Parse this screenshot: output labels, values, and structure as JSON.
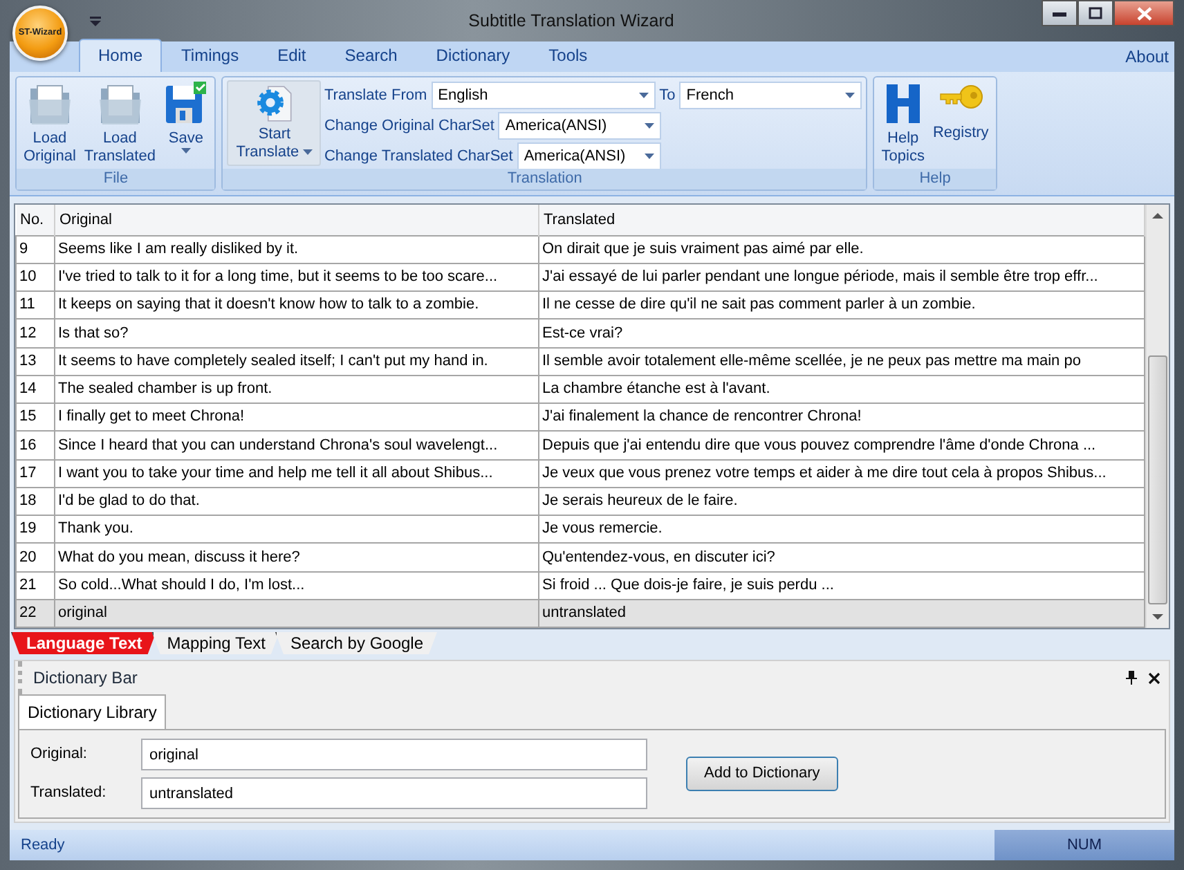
{
  "window": {
    "title": "Subtitle Translation Wizard",
    "app_button": "ST-Wizard"
  },
  "ribbon_tabs": [
    {
      "label": "Home",
      "selected": true
    },
    {
      "label": "Timings",
      "selected": false
    },
    {
      "label": "Edit",
      "selected": false
    },
    {
      "label": "Search",
      "selected": false
    },
    {
      "label": "Dictionary",
      "selected": false
    },
    {
      "label": "Tools",
      "selected": false
    }
  ],
  "about_link": "About",
  "ribbon_groups": [
    {
      "kind": "buttons",
      "label": "File",
      "buttons": [
        {
          "label": "Load Original",
          "kind": "folder",
          "dropdown": false
        },
        {
          "label": "Load Translated",
          "kind": "folder",
          "dropdown": false
        },
        {
          "label": "Save",
          "kind": "save",
          "dropdown": true
        }
      ]
    },
    {
      "kind": "translation",
      "label": "Translation",
      "start_button": {
        "label": "Start Translate",
        "dropdown": true
      },
      "fields": [
        {
          "label": "Translate From",
          "value": "English"
        },
        {
          "label": "Change Original CharSet",
          "value": "America(ANSI)"
        },
        {
          "label": "Change Translated CharSet",
          "value": "America(ANSI)"
        }
      ],
      "to": {
        "label": "To",
        "value": "French"
      }
    },
    {
      "kind": "buttons",
      "label": "Help",
      "buttons": [
        {
          "label": "Help Topics",
          "kind": "help",
          "dropdown": false
        },
        {
          "label": "Registry",
          "kind": "key",
          "dropdown": false
        }
      ]
    }
  ],
  "table": {
    "columns": [
      "No.",
      "Original",
      "Translated"
    ],
    "rows": [
      {
        "no": "9",
        "original": "Seems like I am really disliked by it.",
        "translated": "On dirait que je suis vraiment pas aimé par elle.",
        "selected": false
      },
      {
        "no": "10",
        "original": "I've tried to talk to it for a long time, but it seems to be too scare...",
        "translated": "J'ai essayé de lui parler pendant une longue période, mais il semble être trop effr...",
        "selected": false
      },
      {
        "no": "11",
        "original": "It keeps on saying that it doesn't know how to talk to a zombie.",
        "translated": "Il ne cesse de dire qu'il ne sait pas comment parler à un zombie.",
        "selected": false
      },
      {
        "no": "12",
        "original": "Is that so?",
        "translated": "Est-ce vrai?",
        "selected": false
      },
      {
        "no": "13",
        "original": "It seems to have completely sealed itself; I can't put my hand in.",
        "translated": "Il semble avoir totalement elle-même scellée, je ne peux pas mettre ma main po",
        "selected": false
      },
      {
        "no": "14",
        "original": "The sealed chamber is up front.",
        "translated": "La chambre étanche est à l'avant.",
        "selected": false
      },
      {
        "no": "15",
        "original": "I finally get to meet Chrona!",
        "translated": "J'ai finalement la chance de rencontrer Chrona!",
        "selected": false
      },
      {
        "no": "16",
        "original": "Since I heard that you can understand Chrona's soul wavelengt...",
        "translated": "Depuis que j'ai entendu dire que vous pouvez comprendre l'âme d'onde Chrona ...",
        "selected": false
      },
      {
        "no": "17",
        "original": "I want you to take your time and help me tell it all about Shibus...",
        "translated": "Je veux que vous prenez votre temps et aider à me dire tout cela à propos Shibus...",
        "selected": false
      },
      {
        "no": "18",
        "original": "I'd be glad to do that.",
        "translated": "Je serais heureux de le faire.",
        "selected": false
      },
      {
        "no": "19",
        "original": "Thank you.",
        "translated": "Je vous remercie.",
        "selected": false
      },
      {
        "no": "20",
        "original": "What do you mean, discuss it here?",
        "translated": "Qu'entendez-vous, en discuter ici?",
        "selected": false
      },
      {
        "no": "21",
        "original": "So cold...What should I do, I'm lost...",
        "translated": "Si froid ... Que dois-je faire, je suis perdu ...",
        "selected": false
      },
      {
        "no": "22",
        "original": "original",
        "translated": "untranslated",
        "selected": true
      }
    ]
  },
  "sheet_tabs": [
    {
      "label": "Language Text",
      "selected": true
    },
    {
      "label": "Mapping Text",
      "selected": false
    },
    {
      "label": "Search by Google",
      "selected": false
    }
  ],
  "dictionary_bar": {
    "title": "Dictionary Bar",
    "tabs": [
      {
        "label": "Dictionary Library",
        "selected": true
      }
    ],
    "fields": [
      {
        "label": "Original:",
        "value": "original"
      },
      {
        "label": "Translated:",
        "value": "untranslated"
      }
    ],
    "button": "Add to Dictionary"
  },
  "status_bar": {
    "left": "Ready",
    "right": "NUM"
  }
}
